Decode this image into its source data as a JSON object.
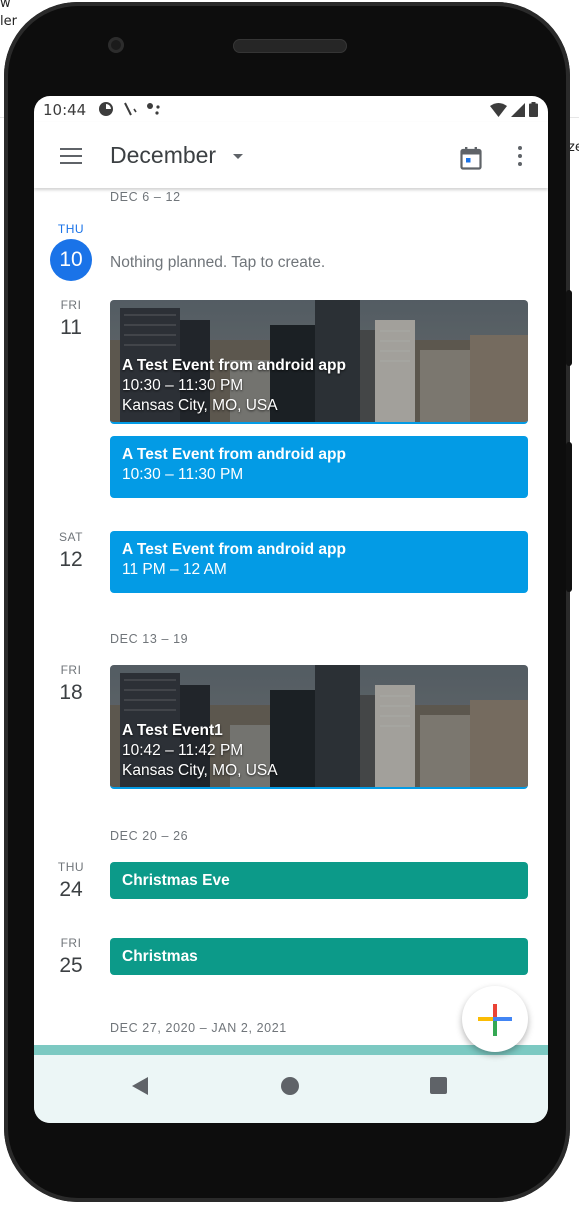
{
  "background": {
    "text_line1": "w",
    "text_line2": "ler",
    "text_right": "ze"
  },
  "status_bar": {
    "time": "10:44"
  },
  "app_bar": {
    "month": "December"
  },
  "weeks": [
    {
      "label": "DEC 6 – 12"
    },
    {
      "label": "DEC 13 – 19"
    },
    {
      "label": "DEC 20 – 26"
    },
    {
      "label": "DEC 27, 2020 – JAN 2, 2021"
    }
  ],
  "days": [
    {
      "dow": "THU",
      "dom": "10",
      "today": true,
      "empty_text": "Nothing planned. Tap to create."
    },
    {
      "dow": "FRI",
      "dom": "11"
    },
    {
      "dow": "SAT",
      "dom": "12"
    },
    {
      "dow": "FRI",
      "dom": "18"
    },
    {
      "dow": "THU",
      "dom": "24"
    },
    {
      "dow": "FRI",
      "dom": "25"
    }
  ],
  "events": [
    {
      "title": "A Test Event from android app",
      "time": "10:30 – 11:30 PM",
      "location": "Kansas City, MO, USA"
    },
    {
      "title": "A Test Event from android app",
      "time": "10:30 – 11:30 PM"
    },
    {
      "title": "A Test Event from android app",
      "time": "11 PM – 12 AM"
    },
    {
      "title": "A Test Event1",
      "time": "10:42 – 11:42 PM",
      "location": "Kansas City, MO, USA"
    },
    {
      "title": "Christmas Eve"
    },
    {
      "title": "Christmas"
    }
  ],
  "colors": {
    "accent": "#1a73e8",
    "event_blue": "#039be5",
    "event_green": "#0c9a89",
    "text_secondary": "#70757a"
  },
  "icons": {
    "menu": "menu-icon",
    "dropdown": "arrow-drop-down-icon",
    "today": "calendar-today-icon",
    "more": "more-vert-icon",
    "fab": "plus-icon"
  }
}
